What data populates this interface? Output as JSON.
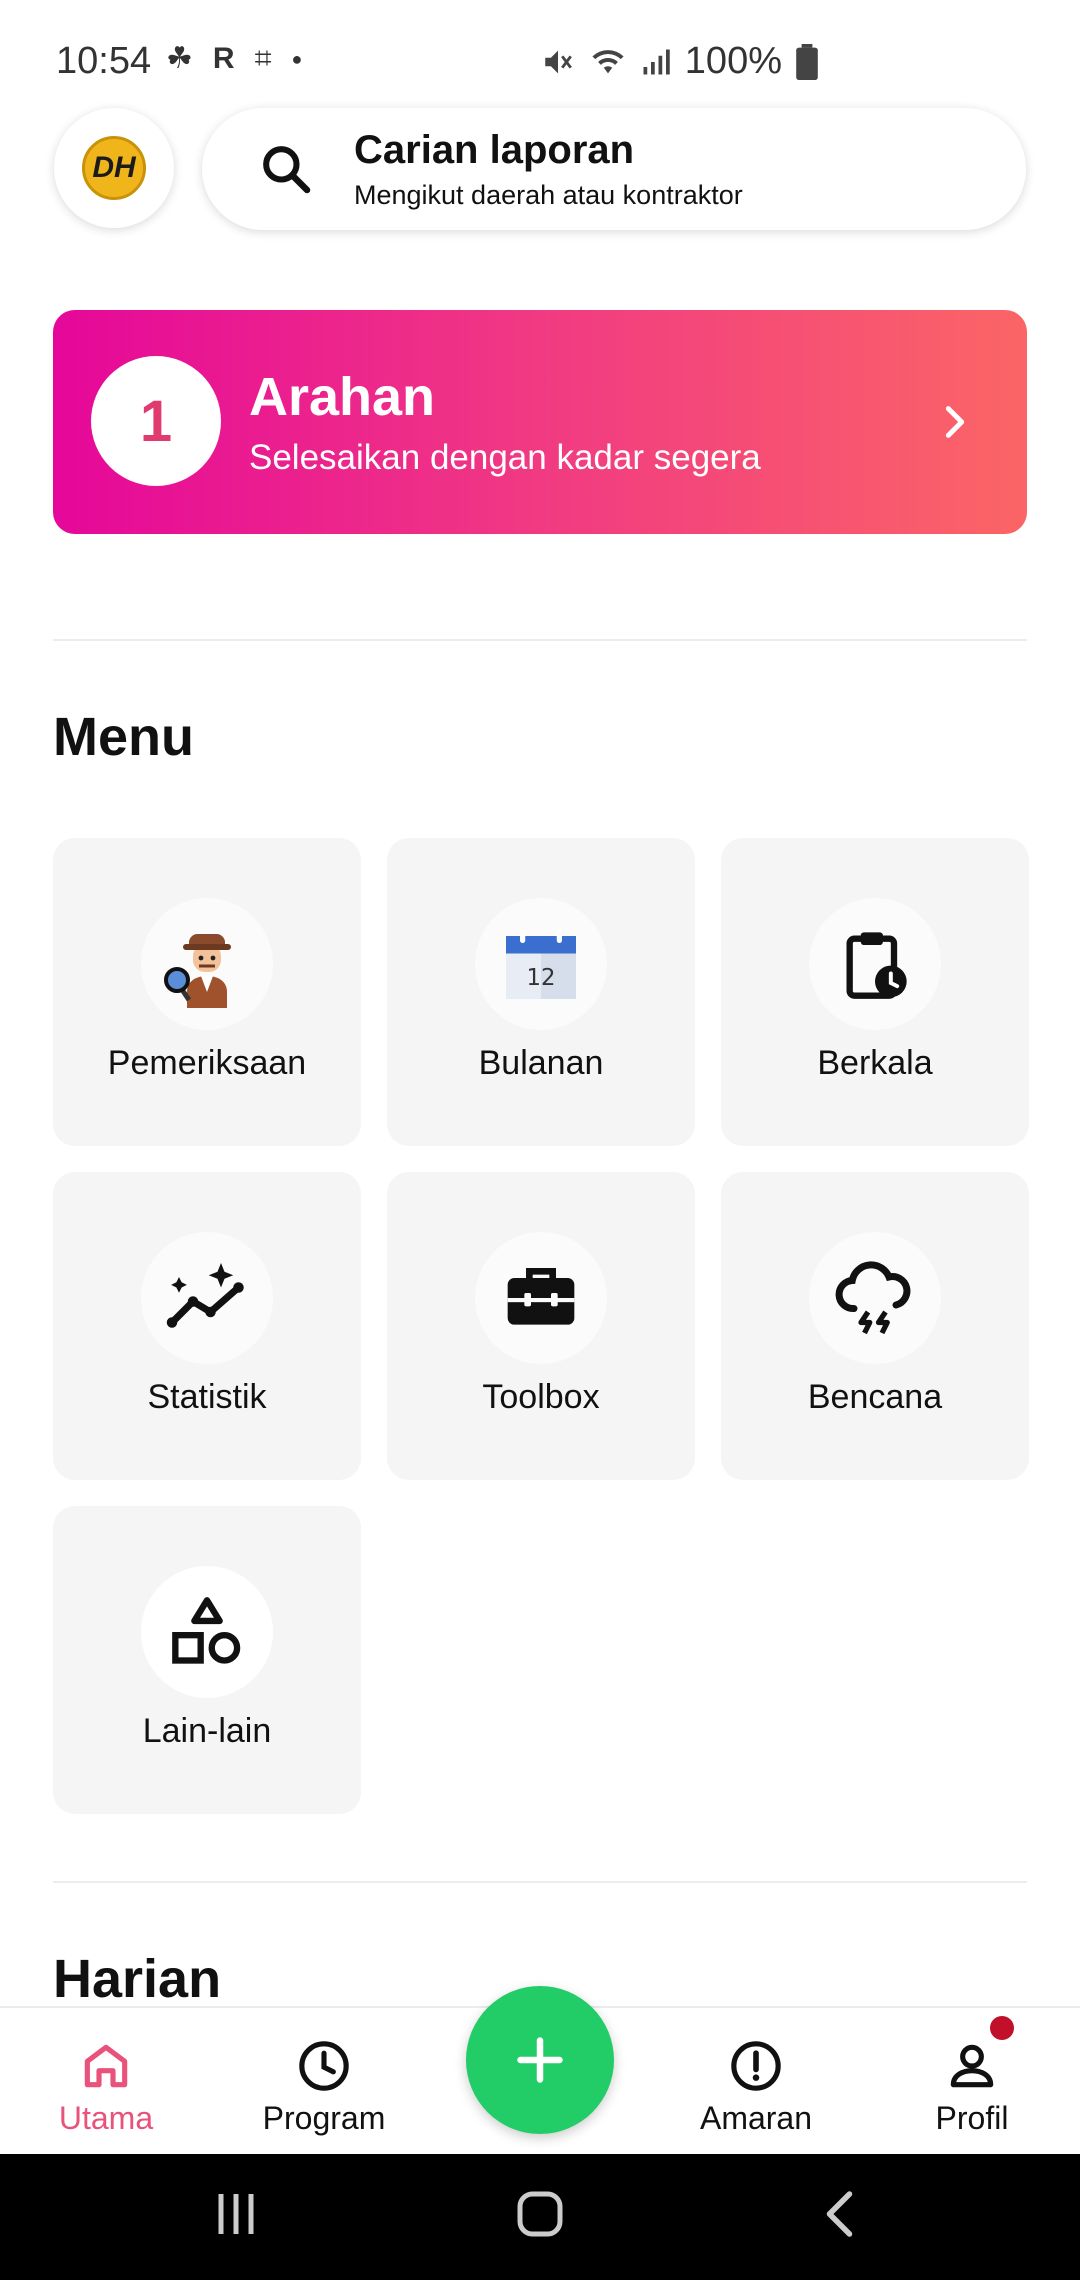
{
  "status_bar": {
    "time": "10:54",
    "battery": "100%",
    "icons": [
      "notification-icon",
      "r-app-icon",
      "slack-icon",
      "dot-icon",
      "mute-icon",
      "wifi-icon",
      "signal-icon",
      "battery-icon"
    ]
  },
  "header": {
    "avatar_text": "DH",
    "search_title": "Carian laporan",
    "search_subtitle": "Mengikut daerah atau kontraktor"
  },
  "banner": {
    "count": "1",
    "title": "Arahan",
    "subtitle": "Selesaikan dengan kadar segera",
    "colors": [
      "#e5079a",
      "#fb6566"
    ]
  },
  "menu": {
    "title": "Menu",
    "items": [
      {
        "label": "Pemeriksaan",
        "icon": "inspector-icon"
      },
      {
        "label": "Bulanan",
        "icon": "calendar-icon",
        "calendar_day": "12"
      },
      {
        "label": "Berkala",
        "icon": "clipboard-clock-icon"
      },
      {
        "label": "Statistik",
        "icon": "chart-sparkle-icon"
      },
      {
        "label": "Toolbox",
        "icon": "toolbox-icon"
      },
      {
        "label": "Bencana",
        "icon": "storm-icon"
      },
      {
        "label": "Lain-lain",
        "icon": "shapes-icon"
      }
    ]
  },
  "harian": {
    "title": "Harian"
  },
  "bottom_nav": {
    "items": [
      {
        "label": "Utama",
        "icon": "home-icon",
        "active": true
      },
      {
        "label": "Program",
        "icon": "clock-icon"
      },
      {
        "label": "Amaran",
        "icon": "alert-icon"
      },
      {
        "label": "Profil",
        "icon": "person-icon"
      }
    ],
    "fab_icon": "plus-icon",
    "accent_color": "#e8527b",
    "fab_color": "#22cc66"
  }
}
